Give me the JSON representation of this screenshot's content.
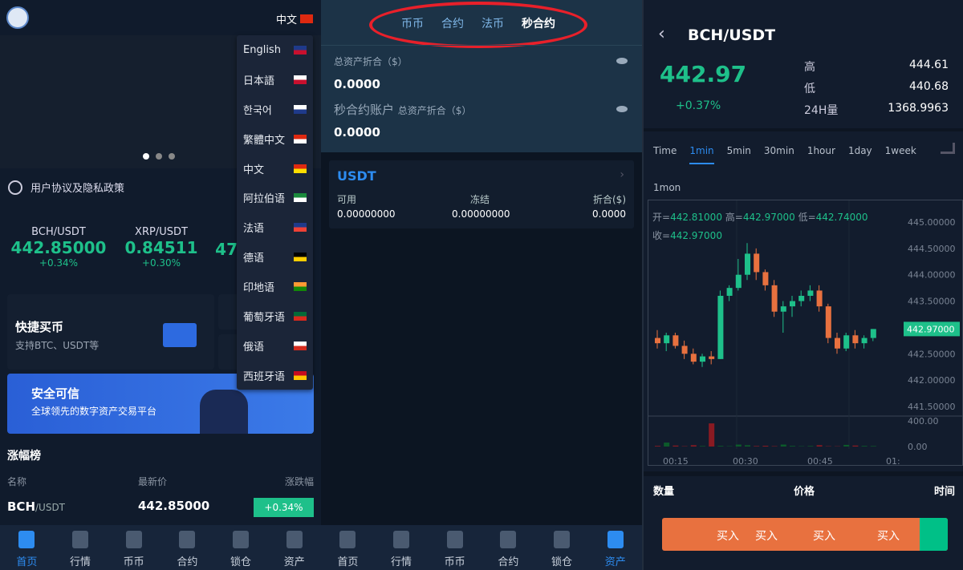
{
  "home": {
    "language_current": "中文",
    "languages": [
      {
        "label": "English",
        "flag": [
          "#1f3a8a",
          "#c8102e"
        ]
      },
      {
        "label": "日本語",
        "flag": [
          "#fff",
          "#c8102e"
        ]
      },
      {
        "label": "한국어",
        "flag": [
          "#fff",
          "#1f3a8a"
        ]
      },
      {
        "label": "繁體中文",
        "flag": [
          "#de2910",
          "#fff"
        ]
      },
      {
        "label": "中文",
        "flag": [
          "#de2910",
          "#ffde00"
        ]
      },
      {
        "label": "阿拉伯语",
        "flag": [
          "#1a8a3c",
          "#fff"
        ]
      },
      {
        "label": "法语",
        "flag": [
          "#1f3a8a",
          "#ef4135"
        ]
      },
      {
        "label": "德语",
        "flag": [
          "#000",
          "#ffce00"
        ]
      },
      {
        "label": "印地语",
        "flag": [
          "#ff9933",
          "#138808"
        ]
      },
      {
        "label": "葡萄牙语",
        "flag": [
          "#046a38",
          "#da291c"
        ]
      },
      {
        "label": "俄语",
        "flag": [
          "#fff",
          "#d52b1e"
        ]
      },
      {
        "label": "西班牙语",
        "flag": [
          "#c60b1e",
          "#ffc400"
        ]
      }
    ],
    "notice": "用户协议及隐私政策",
    "tickers": [
      {
        "pair": "BCH/USDT",
        "price": "442.85000",
        "change": "+0.34%"
      },
      {
        "pair": "XRP/USDT",
        "price": "0.84511",
        "change": "+0.30%"
      },
      {
        "pair": "",
        "price": "47",
        "change": ""
      }
    ],
    "quick_buy_title": "快捷买币",
    "quick_buy_sub": "支持BTC、USDT等",
    "banner_title": "安全可信",
    "banner_sub": "全球领先的数字资产交易平台",
    "ranking_title": "涨幅榜",
    "ranking_headers": [
      "名称",
      "最新价",
      "涨跌幅"
    ],
    "ranking_rows": [
      {
        "base": "BCH",
        "quote": "/USDT",
        "price": "442.85000",
        "change": "+0.34%"
      }
    ]
  },
  "assets": {
    "tabs": [
      "币币",
      "合约",
      "法币",
      "秒合约"
    ],
    "total_label": "总资产折合（$）",
    "total_value": "0.0000",
    "second_label": "秒合约账户",
    "second_sub": "总资产折合（$）",
    "second_value": "0.0000",
    "coin": "USDT",
    "cols": [
      "可用",
      "冻结",
      "折合($)"
    ],
    "vals": [
      "0.00000000",
      "0.00000000",
      "0.0000"
    ]
  },
  "tabbar": [
    "首页",
    "行情",
    "币币",
    "合约",
    "锁仓",
    "资产"
  ],
  "market": {
    "pair": "BCH/USDT",
    "price": "442.97",
    "change": "+0.37%",
    "stats": [
      {
        "label": "高",
        "value": "444.61"
      },
      {
        "label": "低",
        "value": "440.68"
      },
      {
        "label": "24H量",
        "value": "1368.9963"
      }
    ],
    "timeframes": [
      "Time",
      "1min",
      "5min",
      "30min",
      "1hour",
      "1day",
      "1week",
      "1mon"
    ],
    "ohlc": {
      "o_label": "开=",
      "o": "442.81000",
      "h_label": "高=",
      "h": "442.97000",
      "l_label": "低=",
      "l": "442.74000",
      "c_label": "收=",
      "c": "442.97000"
    },
    "price_ticks": [
      "445.00000",
      "444.50000",
      "444.00000",
      "443.50000",
      "443.00000",
      "442.50000",
      "442.00000",
      "441.50000"
    ],
    "vol_ticks": [
      "400.00",
      "0.00"
    ],
    "time_ticks": [
      "00:15",
      "00:30",
      "00:45",
      "01:"
    ],
    "last_price": "442.97000",
    "trade_headers": [
      "数量",
      "价格",
      "时间"
    ],
    "buy_labels": [
      "买入",
      "买入",
      "买入",
      "买入"
    ],
    "colors": {
      "up": "#1ec08a",
      "down": "#e8713f"
    }
  },
  "chart_data": {
    "type": "candlestick",
    "ylim": [
      441.5,
      445
    ],
    "candles": [
      [
        442.8,
        442.95,
        442.6,
        442.7
      ],
      [
        442.7,
        442.9,
        442.55,
        442.85
      ],
      [
        442.85,
        442.9,
        442.6,
        442.65
      ],
      [
        442.65,
        442.75,
        442.4,
        442.5
      ],
      [
        442.5,
        442.6,
        442.3,
        442.35
      ],
      [
        442.35,
        442.5,
        442.25,
        442.45
      ],
      [
        442.45,
        442.55,
        442.3,
        442.4
      ],
      [
        442.4,
        443.7,
        442.4,
        443.6
      ],
      [
        443.6,
        443.8,
        443.5,
        443.75
      ],
      [
        443.75,
        444.3,
        443.7,
        444.0
      ],
      [
        444.0,
        444.6,
        443.9,
        444.4
      ],
      [
        444.4,
        444.5,
        443.9,
        444.05
      ],
      [
        444.05,
        444.1,
        443.7,
        443.8
      ],
      [
        443.8,
        443.9,
        443.2,
        443.3
      ],
      [
        443.3,
        443.5,
        442.9,
        443.4
      ],
      [
        443.4,
        443.6,
        443.2,
        443.5
      ],
      [
        443.5,
        443.7,
        443.4,
        443.6
      ],
      [
        443.6,
        443.8,
        443.5,
        443.7
      ],
      [
        443.7,
        443.8,
        443.3,
        443.4
      ],
      [
        443.4,
        443.45,
        442.7,
        442.8
      ],
      [
        442.8,
        442.9,
        442.5,
        442.6
      ],
      [
        442.6,
        442.9,
        442.55,
        442.85
      ],
      [
        442.85,
        442.95,
        442.6,
        442.7
      ],
      [
        442.7,
        442.85,
        442.6,
        442.8
      ],
      [
        442.8,
        442.97,
        442.74,
        442.97
      ]
    ],
    "volume": [
      10,
      60,
      15,
      5,
      20,
      8,
      350,
      10,
      5,
      30,
      20,
      8,
      12,
      6,
      30,
      10,
      5,
      8,
      20,
      5,
      4,
      25,
      15,
      10,
      8
    ]
  }
}
